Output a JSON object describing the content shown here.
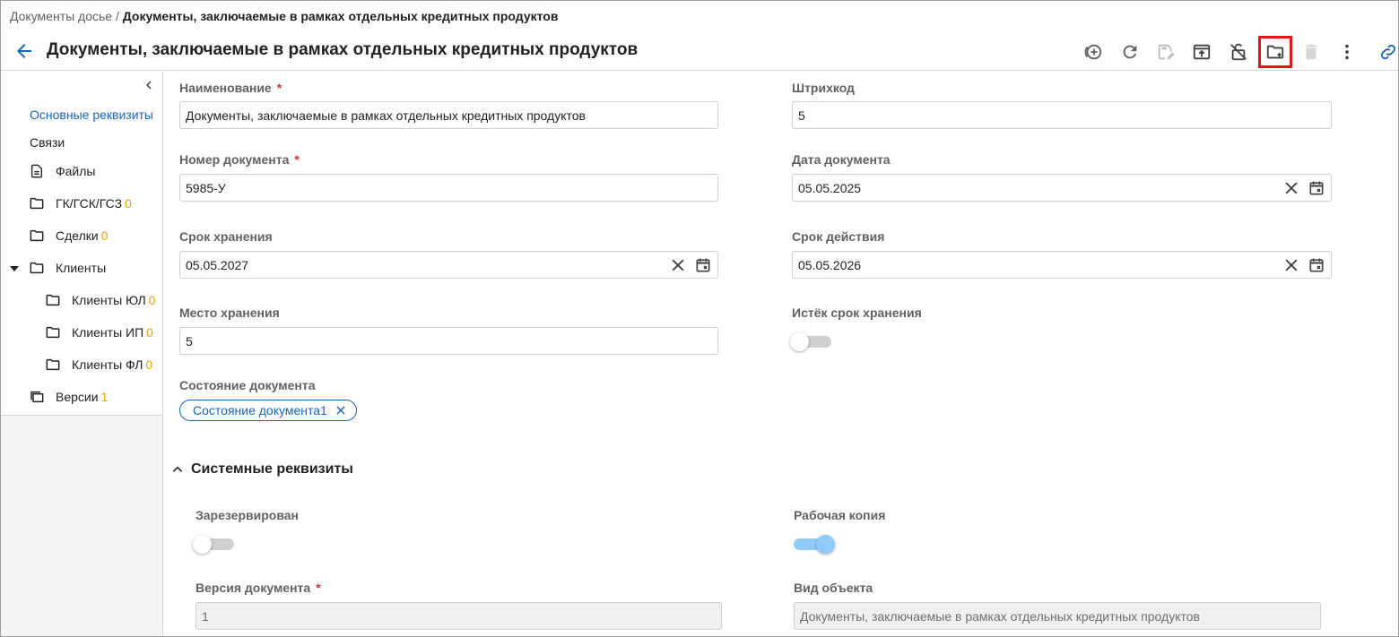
{
  "breadcrumb": {
    "root": "Документы досье",
    "separator": " / ",
    "current": "Документы, заключаемые в рамках отдельных кредитных продуктов"
  },
  "header": {
    "title": "Документы, заключаемые в рамках отдельных кредитных продуктов"
  },
  "toolbar": {
    "icons": [
      "add-circle-icon",
      "refresh-icon",
      "edit-save-icon",
      "open-in-new-icon",
      "unlock-icon",
      "folder-upload-icon",
      "delete-icon",
      "more-vertical-icon",
      "link-icon"
    ],
    "highlighted": "folder-upload-icon"
  },
  "sidebar": {
    "items": [
      {
        "label": "Основные реквизиты",
        "count": "",
        "icon": ""
      },
      {
        "label": "Связи",
        "count": "",
        "icon": ""
      },
      {
        "label": "Файлы",
        "count": "",
        "icon": "file-icon"
      },
      {
        "label": "ГК/ГСК/ГСЗ",
        "count": "0",
        "icon": "folder-icon"
      },
      {
        "label": "Сделки",
        "count": "0",
        "icon": "folder-icon"
      },
      {
        "label": "Клиенты",
        "count": "",
        "icon": "folder-icon"
      },
      {
        "label": "Клиенты ЮЛ",
        "count": "0",
        "icon": "folder-icon"
      },
      {
        "label": "Клиенты ИП",
        "count": "0",
        "icon": "folder-icon"
      },
      {
        "label": "Клиенты ФЛ",
        "count": "0",
        "icon": "folder-icon"
      },
      {
        "label": "Версии",
        "count": "1",
        "icon": "versions-icon"
      }
    ]
  },
  "form": {
    "name": {
      "label": "Наименование",
      "value": "Документы, заключаемые в рамках отдельных кредитных продуктов"
    },
    "barcode": {
      "label": "Штрихкод",
      "value": "5"
    },
    "doc_number": {
      "label": "Номер документа",
      "value": "5985-У"
    },
    "doc_date": {
      "label": "Дата документа",
      "value": "05.05.2025"
    },
    "storage_term": {
      "label": "Срок хранения",
      "value": "05.05.2027"
    },
    "validity_term": {
      "label": "Срок действия",
      "value": "05.05.2026"
    },
    "storage_place": {
      "label": "Место хранения",
      "value": "5"
    },
    "storage_expired": {
      "label": "Истёк срок хранения",
      "on": false
    },
    "doc_state": {
      "label": "Состояние документа",
      "chip": "Состояние документа1"
    }
  },
  "system": {
    "title": "Системные реквизиты",
    "reserved": {
      "label": "Зарезервирован",
      "on": false
    },
    "working_copy": {
      "label": "Рабочая копия",
      "on": true
    },
    "doc_version": {
      "label": "Версия документа",
      "value": "1"
    },
    "object_type": {
      "label": "Вид объекта",
      "value": "Документы, заключаемые в рамках отдельных кредитных продуктов"
    }
  },
  "colors": {
    "accent": "#1565c0",
    "count": "#f0a000",
    "required": "#d32f2f",
    "highlight": "#e01818",
    "toggle_on": "#90caf9"
  }
}
